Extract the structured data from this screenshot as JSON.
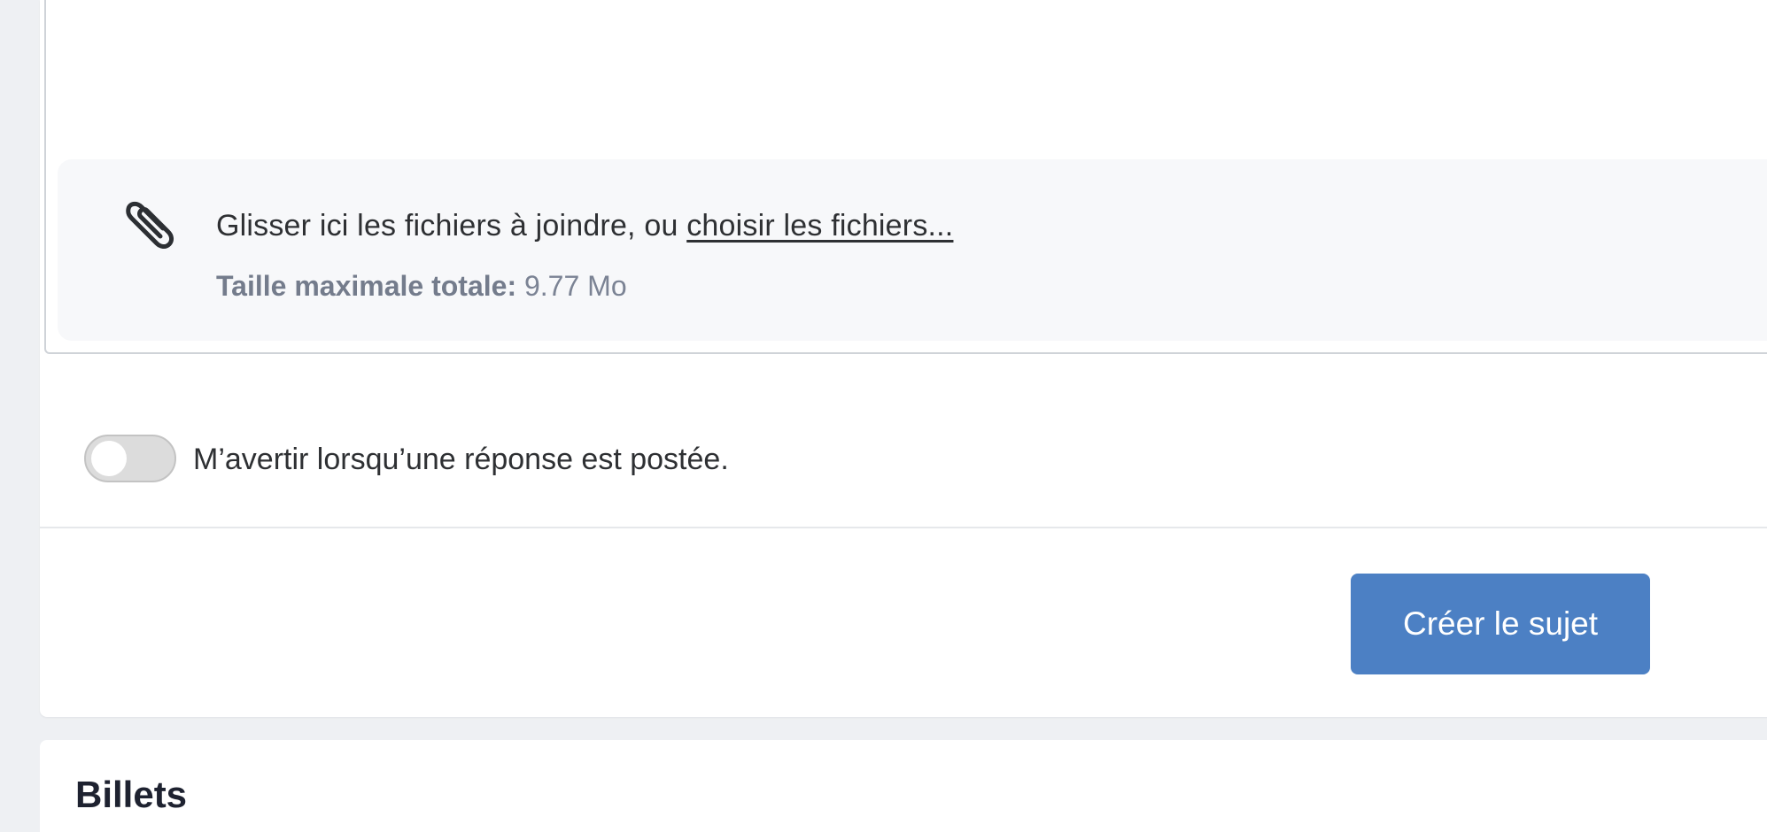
{
  "attachments": {
    "drop_text": "Glisser ici les fichiers à joindre, ou ",
    "choose_link": "choisir les fichiers...",
    "max_size_label": "Taille maximale totale:",
    "max_size_value": " 9.77 Mo",
    "icon": "paperclip-icon"
  },
  "notify": {
    "label": "M’avertir lorsqu’une réponse est postée.",
    "enabled": false
  },
  "actions": {
    "submit_label": "Créer le sujet"
  },
  "next_section": {
    "title": "Billets"
  },
  "colors": {
    "primary": "#4c80c4",
    "background": "#eef0f3",
    "dropzone": "#f7f8fa"
  }
}
